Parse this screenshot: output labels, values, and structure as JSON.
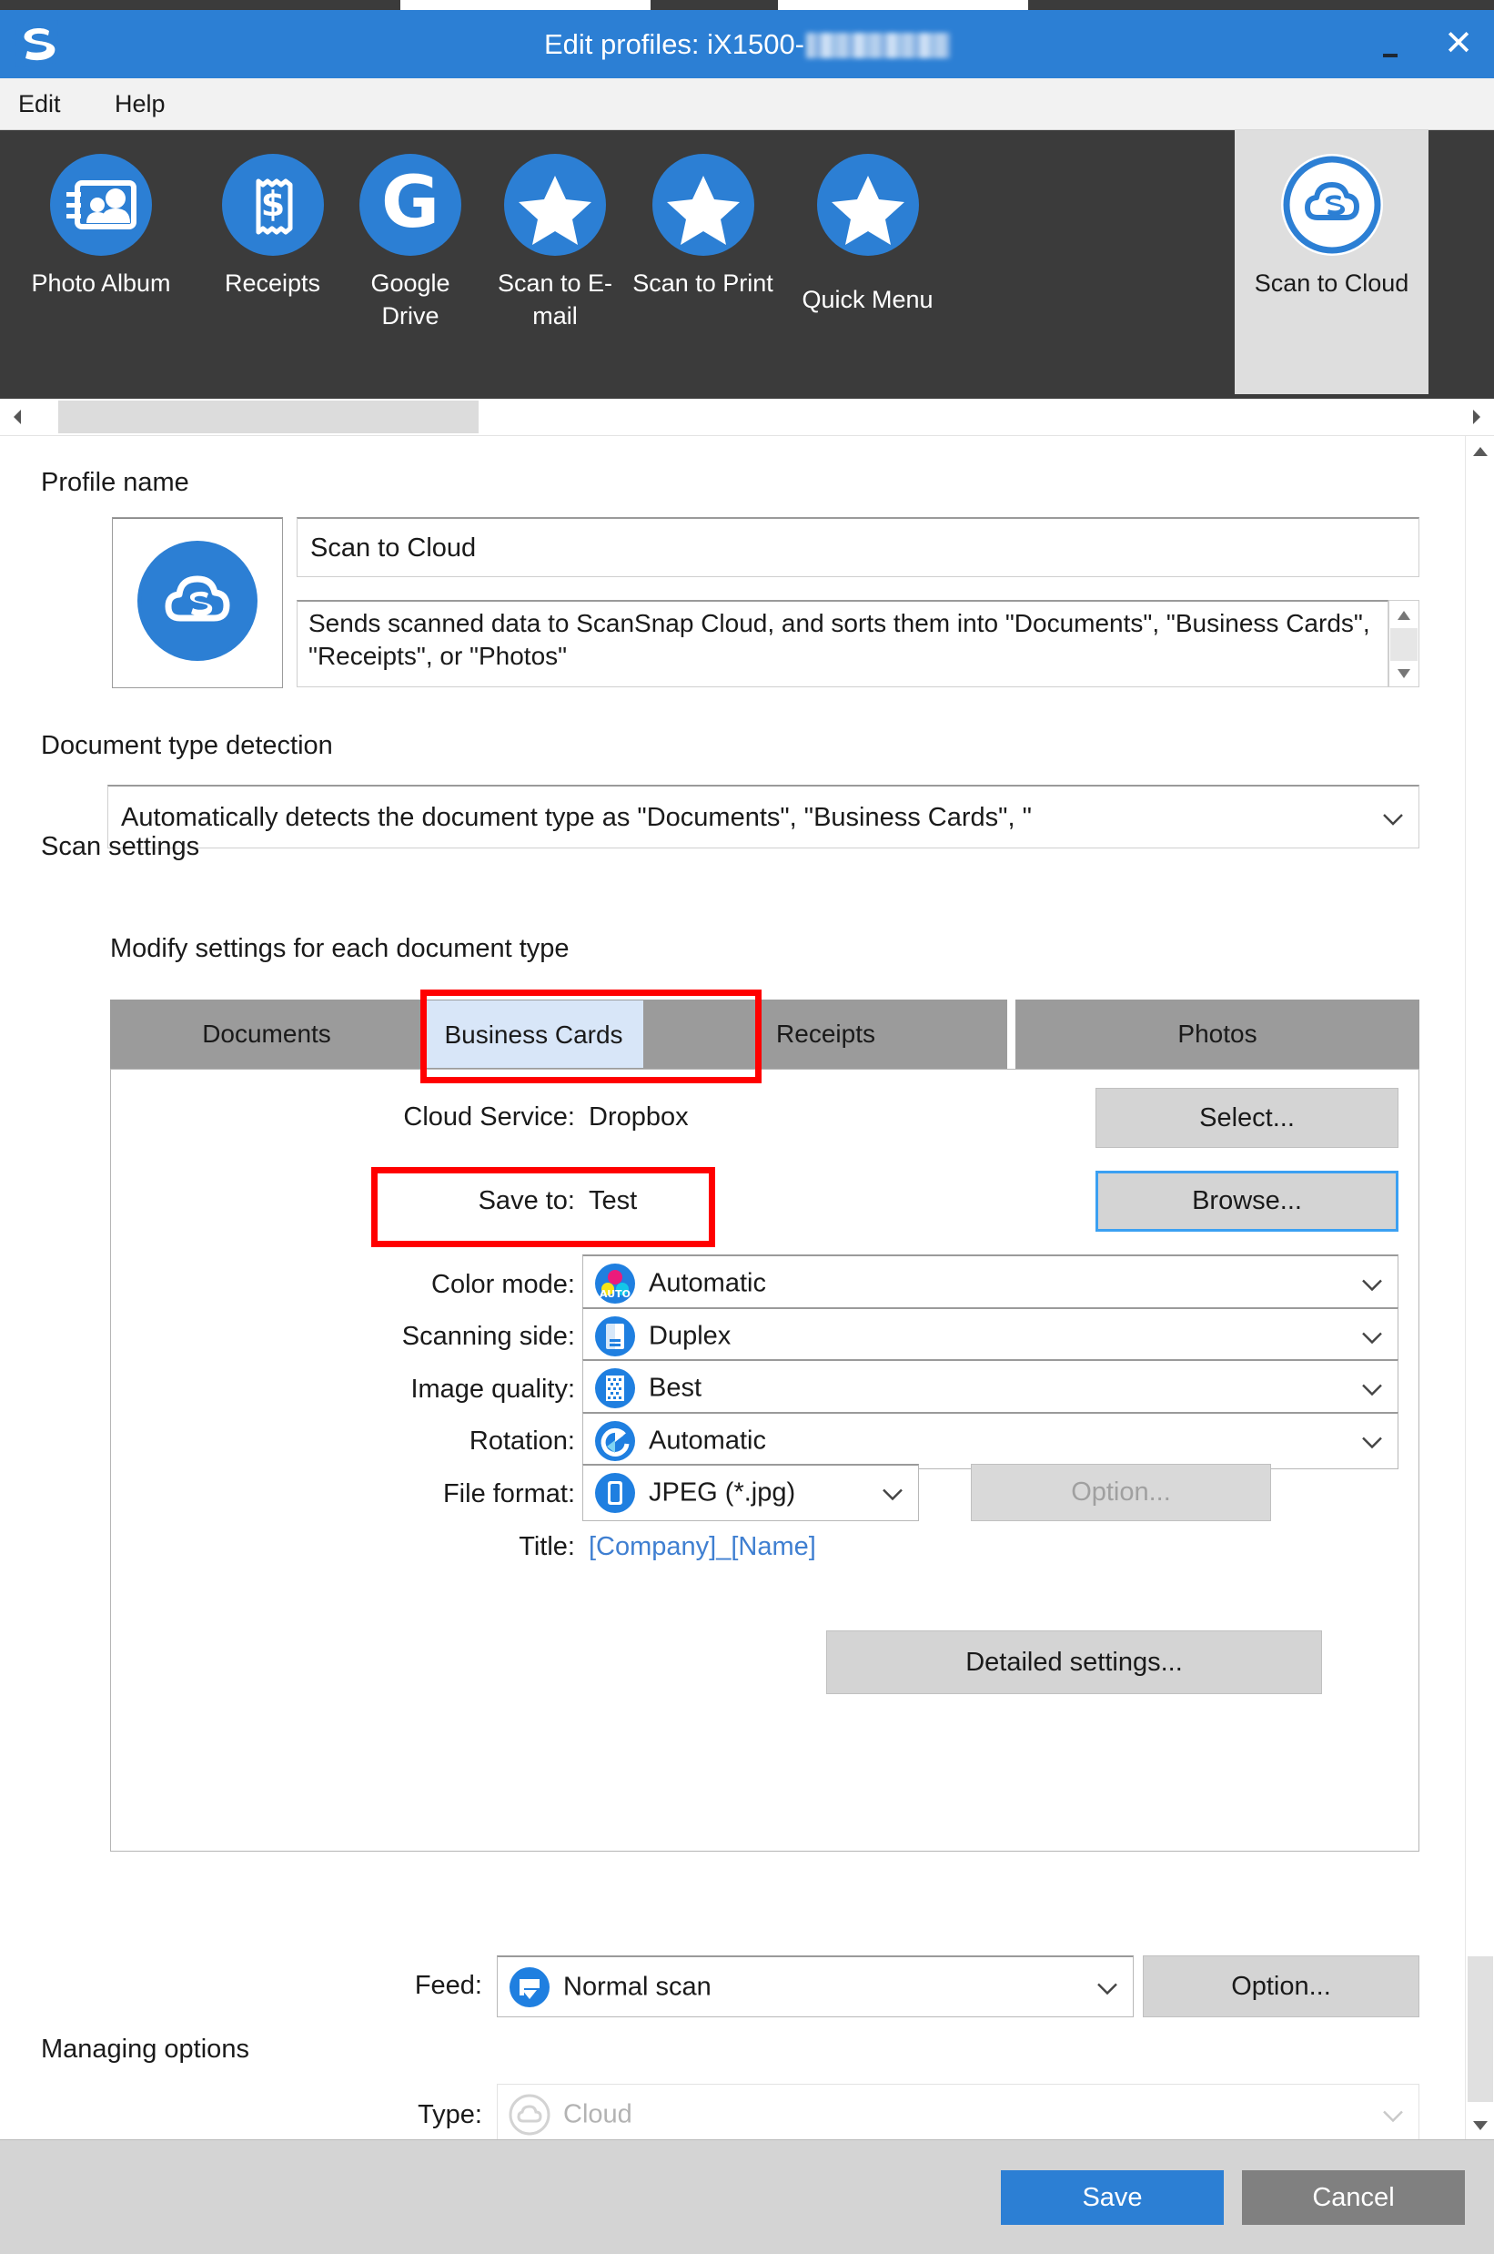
{
  "window": {
    "title_prefix": "Edit profiles: iX1500-",
    "title_redacted": "",
    "logo_name": "scansnap-logo",
    "minimize_label": "",
    "close_label": "✕",
    "accent_color": "#2c7fd4",
    "chrome_color": "#3b3b3b"
  },
  "menubar": {
    "items": [
      {
        "label": "Edit"
      },
      {
        "label": "Help"
      }
    ]
  },
  "toolbar": {
    "profiles": [
      {
        "label": "Photo Album",
        "icon": "photo-album-icon",
        "selected": false
      },
      {
        "label": "Receipts",
        "icon": "receipt-icon",
        "selected": false
      },
      {
        "label": "Google Drive",
        "icon": "google-drive-icon",
        "selected": false
      },
      {
        "label": "Scan to E-mail",
        "icon": "star-icon",
        "selected": false
      },
      {
        "label": "Scan to Print",
        "icon": "star-icon",
        "selected": false
      },
      {
        "label": "Quick Menu",
        "icon": "star-icon",
        "selected": false
      },
      {
        "label": "Scan to Cloud",
        "icon": "scansnap-cloud-icon",
        "selected": true
      }
    ]
  },
  "profile": {
    "section_label": "Profile name",
    "icon": "scansnap-cloud-icon",
    "name_value": "Scan to Cloud",
    "description_value": "Sends scanned data to ScanSnap Cloud, and sorts them into \"Documents\", \"Business Cards\", \"Receipts\", or \"Photos\""
  },
  "document_type_detection": {
    "section_label": "Document type detection",
    "selected_value": "Automatically detects the document type as \"Documents\", \"Business Cards\", \""
  },
  "scan_settings": {
    "section_label": "Scan settings",
    "sub_label": "Modify settings for each document type",
    "tabs": [
      {
        "label": "Documents",
        "active": false
      },
      {
        "label": "Business Cards",
        "active": true
      },
      {
        "label": "Receipts",
        "active": false
      },
      {
        "label": "Photos",
        "active": false
      }
    ],
    "rows": {
      "cloud_service_label": "Cloud Service:",
      "cloud_service_value": "Dropbox",
      "select_button": "Select...",
      "save_to_label": "Save to:",
      "save_to_value": "Test",
      "browse_button": "Browse...",
      "color_mode_label": "Color mode:",
      "color_mode_value": "Automatic",
      "color_mode_icon": "color-auto-icon",
      "scanning_side_label": "Scanning side:",
      "scanning_side_value": "Duplex",
      "scanning_side_icon": "duplex-icon",
      "image_quality_label": "Image quality:",
      "image_quality_value": "Best",
      "image_quality_icon": "quality-icon",
      "rotation_label": "Rotation:",
      "rotation_value": "Automatic",
      "rotation_icon": "rotate-icon",
      "file_format_label": "File format:",
      "file_format_value": "JPEG (*.jpg)",
      "file_format_icon": "file-icon",
      "file_format_option_button": "Option...",
      "title_label": "Title:",
      "title_value": "[Company]_[Name]",
      "detailed_settings_button": "Detailed settings..."
    }
  },
  "feed": {
    "label": "Feed:",
    "value": "Normal scan",
    "icon": "feed-icon",
    "option_button": "Option..."
  },
  "managing_options": {
    "section_label": "Managing options",
    "type_label": "Type:",
    "type_value": "Cloud",
    "type_icon": "scansnap-cloud-icon"
  },
  "footer": {
    "save_label": "Save",
    "cancel_label": "Cancel",
    "save_color": "#2c7fd4",
    "cancel_color": "#808080"
  },
  "annotations": {
    "highlight_color": "#ff0000",
    "boxes": [
      {
        "target": "business-cards-tab"
      },
      {
        "target": "save-to-row"
      }
    ]
  }
}
